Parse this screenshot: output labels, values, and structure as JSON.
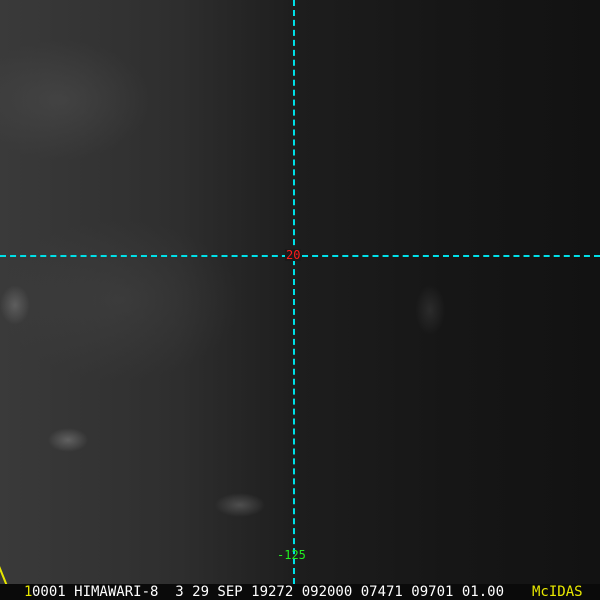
{
  "grid": {
    "latitude_label": "20",
    "longitude_label": "-125",
    "line_color": "#00e0e8"
  },
  "status_bar": {
    "frame_number": "1",
    "info": "0001 HIMAWARI-8  3 29 SEP 19272 092000 07471 09701 01.00",
    "brand": "McIDAS"
  },
  "colors": {
    "lat_label": "#ff1a1a",
    "lon_label": "#22ee22",
    "brand": "#e8e800"
  }
}
